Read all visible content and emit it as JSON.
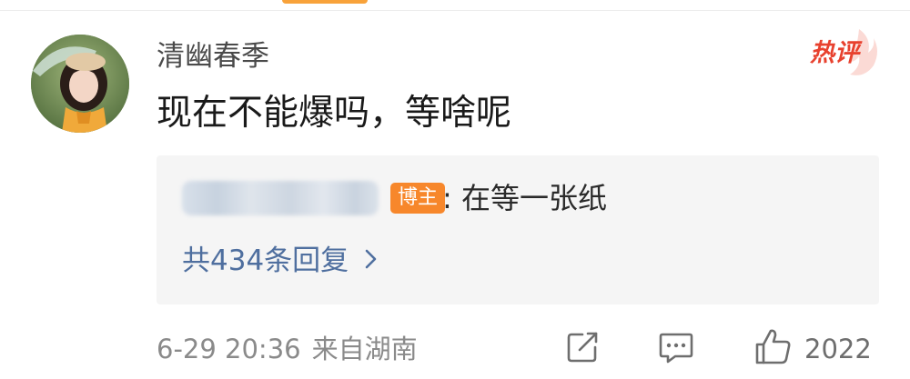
{
  "colors": {
    "accent_orange": "#f8a23a",
    "hot_red": "#e8412e",
    "blogger_badge": "#f7872b",
    "reply_link_blue": "#4f6f9f",
    "reply_bg": "#f5f5f5"
  },
  "comment": {
    "username": "清幽春季",
    "hot_badge_label": "热评",
    "text": "现在不能爆吗，等啥呢",
    "reply": {
      "author": "",
      "author_badge": "博主",
      "text": ": 在等一张纸",
      "reply_count_label": "共434条回复"
    },
    "date": "6-29 20:36",
    "location": "来自湖南",
    "like_count": "2022"
  },
  "icons": {
    "avatar": "user-avatar",
    "share": "share-edit-icon",
    "comment": "comment-icon",
    "like": "thumbs-up-icon",
    "reply_chevron": "chevron-right-icon",
    "hot_flame": "flame-icon"
  }
}
